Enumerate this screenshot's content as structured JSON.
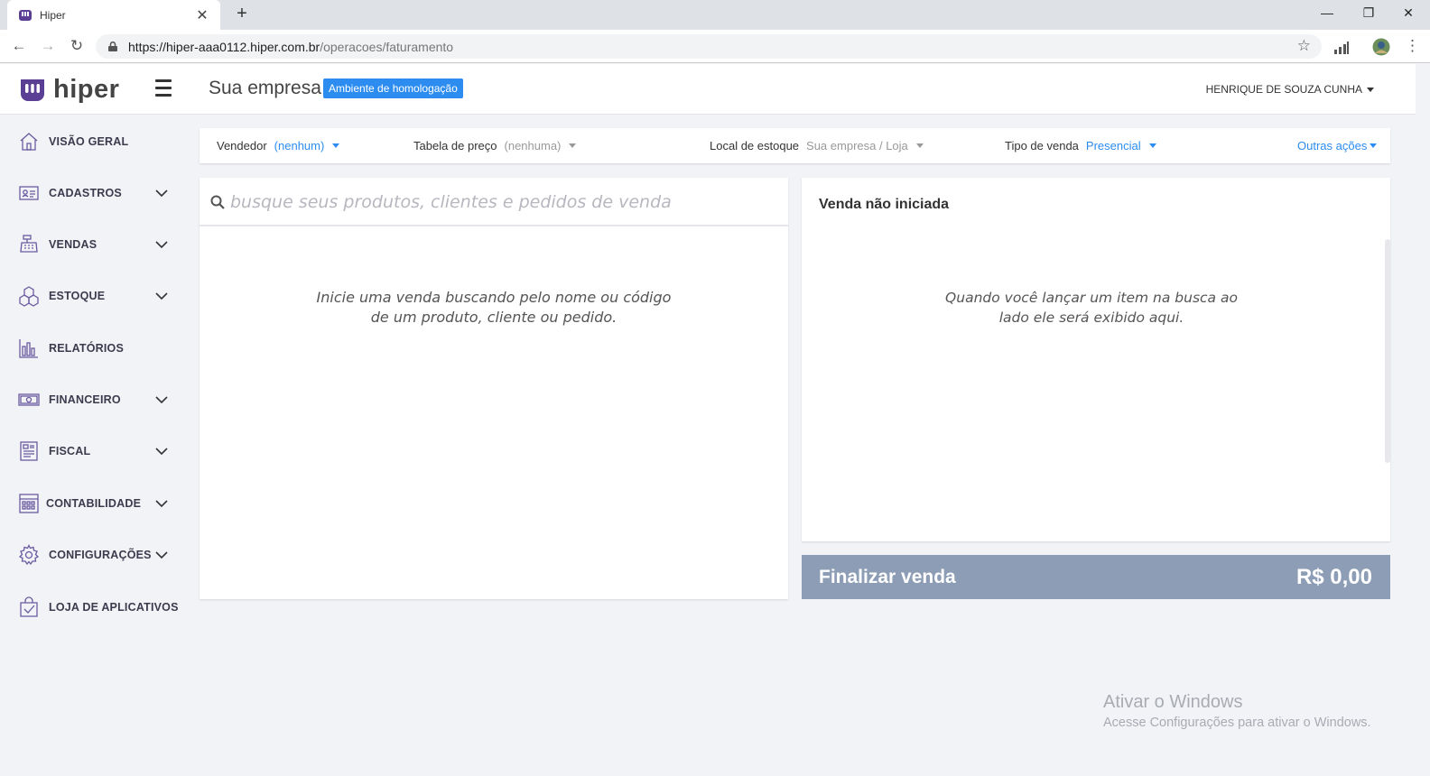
{
  "browser": {
    "tab_title": "Hiper",
    "url_host": "https://hiper-aaa0112.hiper.com.br",
    "url_path": "/operacoes/faturamento"
  },
  "header": {
    "logo_text": "hiper",
    "company": "Sua empresa",
    "environment_badge": "Ambiente de homologação",
    "user_name": "HENRIQUE DE SOUZA CUNHA"
  },
  "sidebar": {
    "items": [
      {
        "label": "VISÃO GERAL",
        "icon": "home-icon",
        "expandable": false
      },
      {
        "label": "CADASTROS",
        "icon": "id-card-icon",
        "expandable": true
      },
      {
        "label": "VENDAS",
        "icon": "cash-register-icon",
        "expandable": true
      },
      {
        "label": "ESTOQUE",
        "icon": "boxes-icon",
        "expandable": true
      },
      {
        "label": "RELATÓRIOS",
        "icon": "bar-chart-icon",
        "expandable": false
      },
      {
        "label": "FINANCEIRO",
        "icon": "money-icon",
        "expandable": true
      },
      {
        "label": "FISCAL",
        "icon": "invoice-icon",
        "expandable": true
      },
      {
        "label": "CONTABILIDADE",
        "icon": "calculator-icon",
        "expandable": true
      },
      {
        "label": "CONFIGURAÇÕES",
        "icon": "gear-icon",
        "expandable": true
      },
      {
        "label": "LOJA DE APLICATIVOS",
        "icon": "app-store-icon",
        "expandable": false
      }
    ]
  },
  "filters": {
    "seller_label": "Vendedor",
    "seller_value": "(nenhum)",
    "price_table_label": "Tabela de preço",
    "price_table_value": "(nenhuma)",
    "stock_label": "Local de estoque",
    "stock_value": "Sua empresa / Loja",
    "sale_type_label": "Tipo de venda",
    "sale_type_value": "Presencial",
    "other_actions": "Outras ações"
  },
  "search": {
    "placeholder": "busque seus produtos, clientes e pedidos de venda",
    "value": ""
  },
  "left_panel": {
    "hint_line1": "Inicie uma venda buscando pelo nome ou código",
    "hint_line2": "de um produto, cliente ou pedido."
  },
  "right_panel": {
    "title": "Venda não iniciada",
    "hint_line1": "Quando você lançar um item na busca ao",
    "hint_line2": "lado ele será exibido aqui."
  },
  "finalize": {
    "label": "Finalizar venda",
    "total": "R$ 0,00"
  },
  "watermark": {
    "title": "Ativar o Windows",
    "subtitle": "Acesse Configurações para ativar o Windows."
  },
  "colors": {
    "accent": "#2d8cf0",
    "brand": "#5b3f95",
    "finalize_bg": "#8d9db5"
  }
}
